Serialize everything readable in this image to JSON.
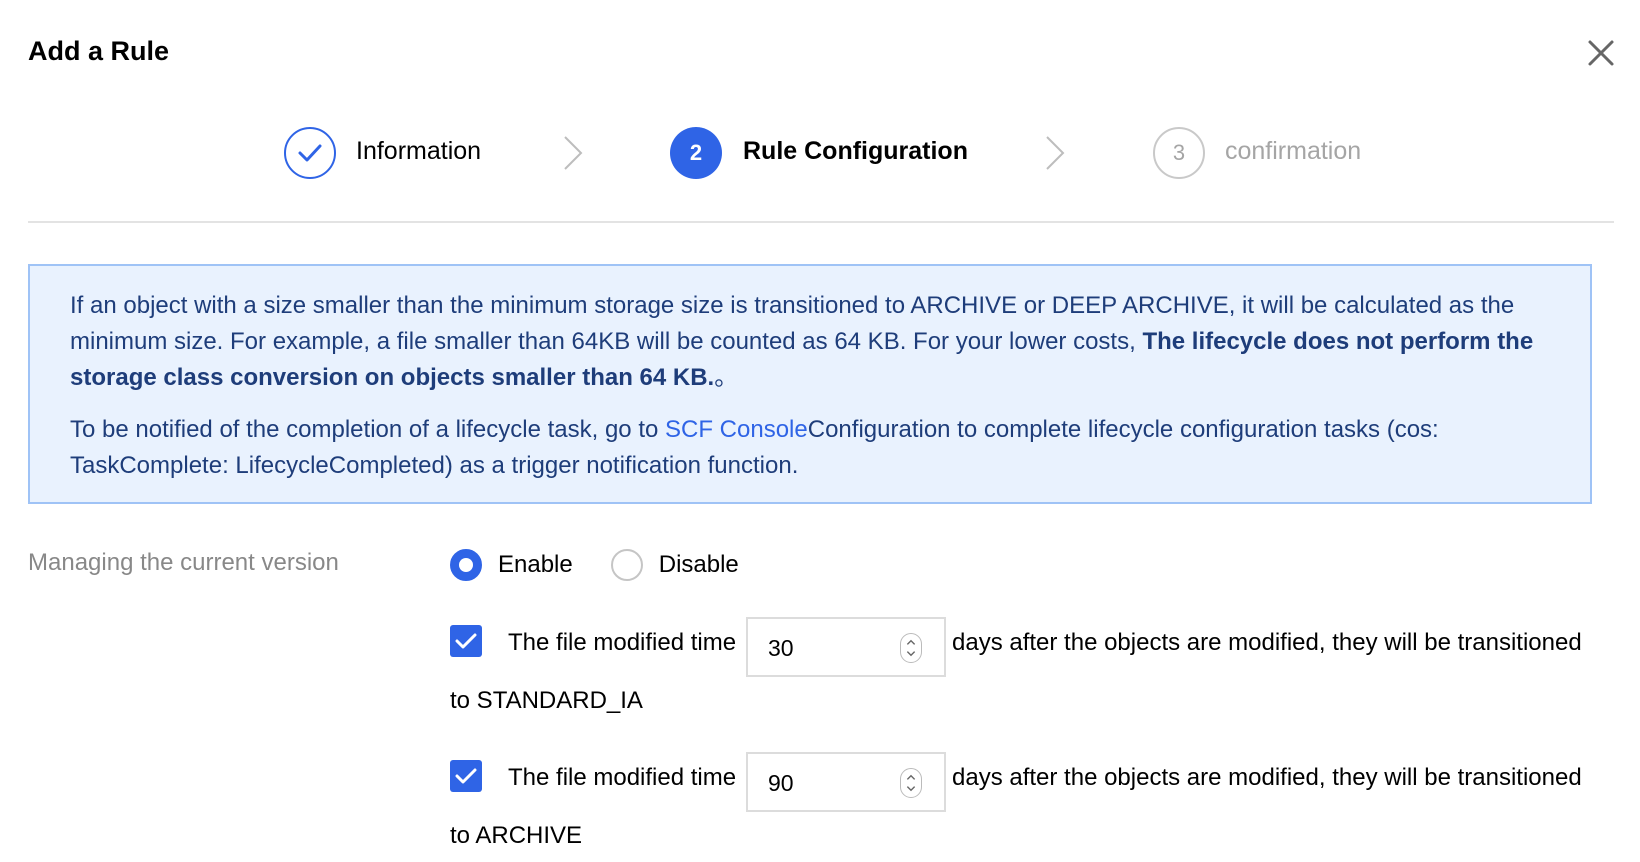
{
  "dialog": {
    "title": "Add a Rule"
  },
  "steps": [
    {
      "number": "1",
      "label": "Information",
      "state": "done"
    },
    {
      "number": "2",
      "label": "Rule Configuration",
      "state": "active"
    },
    {
      "number": "3",
      "label": "confirmation",
      "state": "pending"
    }
  ],
  "notice": {
    "p1_text": "If an object with a size smaller than the minimum storage size is transitioned to ARCHIVE or DEEP ARCHIVE, it will be calculated as the minimum size. For example, a file smaller than 64KB will be counted as 64 KB. For your lower costs, ",
    "p1_bold": "The lifecycle does not perform the storage class conversion on objects smaller than 64 KB.",
    "p1_end": "。",
    "p2_before": "To be notified of the completion of a lifecycle task, go to ",
    "p2_link": "SCF Console",
    "p2_after": "Configuration to complete lifecycle configuration tasks (cos: TaskComplete: LifecycleCompleted) as a trigger notification function."
  },
  "current_version": {
    "label": "Managing the current version",
    "options": [
      {
        "label": "Enable",
        "selected": true
      },
      {
        "label": "Disable",
        "selected": false
      }
    ]
  },
  "rules": [
    {
      "checked": true,
      "prefix": "The file modified time",
      "days": "30",
      "suffix": "days after the objects are modified, they will be transitioned",
      "target": "to STANDARD_IA"
    },
    {
      "checked": true,
      "prefix": "The file modified time",
      "days": "90",
      "suffix": "days after the objects are modified, they will be transitioned",
      "target": "to ARCHIVE"
    }
  ],
  "colors": {
    "accent": "#2f64e6",
    "notice_bg": "#e9f2fe",
    "notice_border": "#9fc3f6",
    "notice_text": "#1e3d7a",
    "muted": "#a5a5a5"
  }
}
